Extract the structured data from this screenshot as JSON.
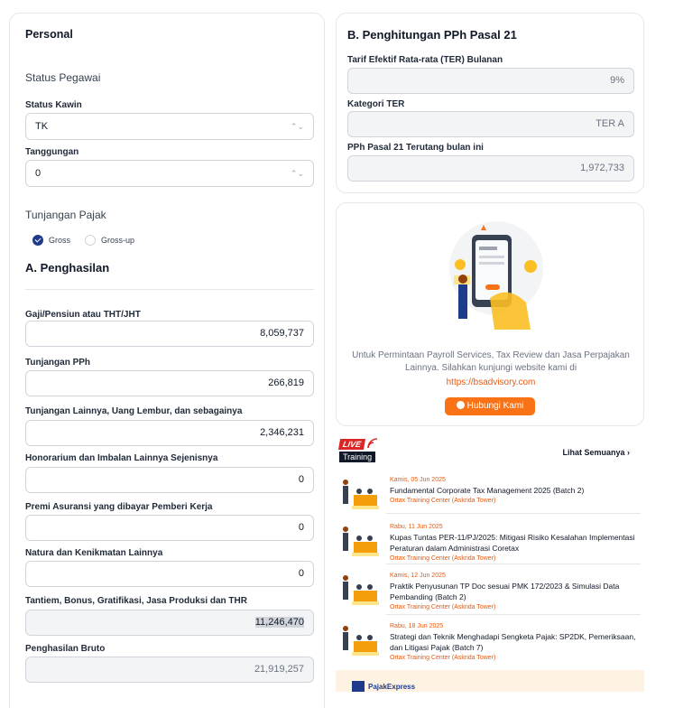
{
  "personal": {
    "title": "Personal",
    "status_pegawai_label": "Status Pegawai",
    "status_kawin_label": "Status Kawin",
    "status_kawin_value": "TK",
    "tanggungan_label": "Tanggungan",
    "tanggungan_value": "0",
    "tunjangan_pajak_label": "Tunjangan Pajak",
    "gross_label": "Gross",
    "grossup_label": "Gross-up"
  },
  "penghasilan": {
    "title": "A. Penghasilan",
    "fields": [
      {
        "label": "Gaji/Pensiun atau THT/JHT",
        "value": "8,059,737"
      },
      {
        "label": "Tunjangan PPh",
        "value": "266,819"
      },
      {
        "label": "Tunjangan Lainnya, Uang Lembur, dan sebagainya",
        "value": "2,346,231"
      },
      {
        "label": "Honorarium dan Imbalan Lainnya Sejenisnya",
        "value": "0"
      },
      {
        "label": "Premi Asuransi yang dibayar Pemberi Kerja",
        "value": "0"
      },
      {
        "label": "Natura dan Kenikmatan Lainnya",
        "value": "0"
      },
      {
        "label": "Tantiem, Bonus, Gratifikasi, Jasa Produksi dan THR",
        "value": "11,246,470"
      },
      {
        "label": "Penghasilan Bruto",
        "value": "21,919,257"
      }
    ]
  },
  "pph21": {
    "title": "B. Penghitungan PPh Pasal 21",
    "ter_label": "Tarif Efektif Rata-rata (TER) Bulanan",
    "ter_value": "9%",
    "kategori_label": "Kategori TER",
    "kategori_value": "TER A",
    "terutang_label": "PPh Pasal 21 Terutang bulan ini",
    "terutang_value": "1,972,733"
  },
  "promo": {
    "text": "Untuk Permintaan Payroll Services, Tax Review dan Jasa Perpajakan Lainnya. Silahkan kunjungi website kami di",
    "link": "https://bsadvisory.com",
    "button": "Hubungi Kami"
  },
  "training": {
    "badge_live": "LIVE",
    "badge_training": "Training",
    "see_all": "Lihat Semuanya",
    "events": [
      {
        "date": "Kamis, 05 Jun 2025",
        "title": "Fundamental Corporate Tax Management 2025 (Batch 2)",
        "location": "Ortax Training Center (Askrida Tower)"
      },
      {
        "date": "Rabu, 11 Jun 2025",
        "title": "Kupas Tuntas PER-11/PJ/2025: Mitigasi Risiko Kesalahan Implementasi Peraturan dalam Administrasi Coretax",
        "location": "Ortax Training Center (Askrida Tower)"
      },
      {
        "date": "Kamis, 12 Jun 2025",
        "title": "Praktik Penyusunan TP Doc sesuai PMK 172/2023 & Simulasi Data Pembanding (Batch 2)",
        "location": "Ortax Training Center (Askrida Tower)"
      },
      {
        "date": "Rabu, 18 Jun 2025",
        "title": "Strategi dan Teknik Menghadapi Sengketa Pajak: SP2DK, Pemeriksaan, dan Litigasi Pajak (Batch 7)",
        "location": "Ortax Training Center (Askrida Tower)"
      }
    ]
  },
  "footer_logo": "PajakExpress",
  "colors": {
    "accent": "#1e3a8a",
    "orange": "#f97316",
    "live_red": "#dc2626"
  }
}
